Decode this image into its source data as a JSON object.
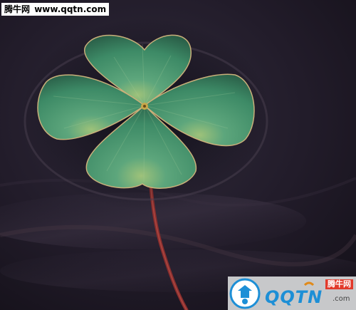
{
  "watermark_top": {
    "cn": "腾牛网",
    "site": "www.qqtn.com"
  },
  "brand": {
    "cn": "腾牛网",
    "en": "QQTN",
    "com": ".com"
  },
  "colors": {
    "leaf": "#3d8a66",
    "background": "#1a1622",
    "stem": "#8a2e2e",
    "accent": "#1d8fd6"
  },
  "subject": "four-leaf-clover-icon"
}
